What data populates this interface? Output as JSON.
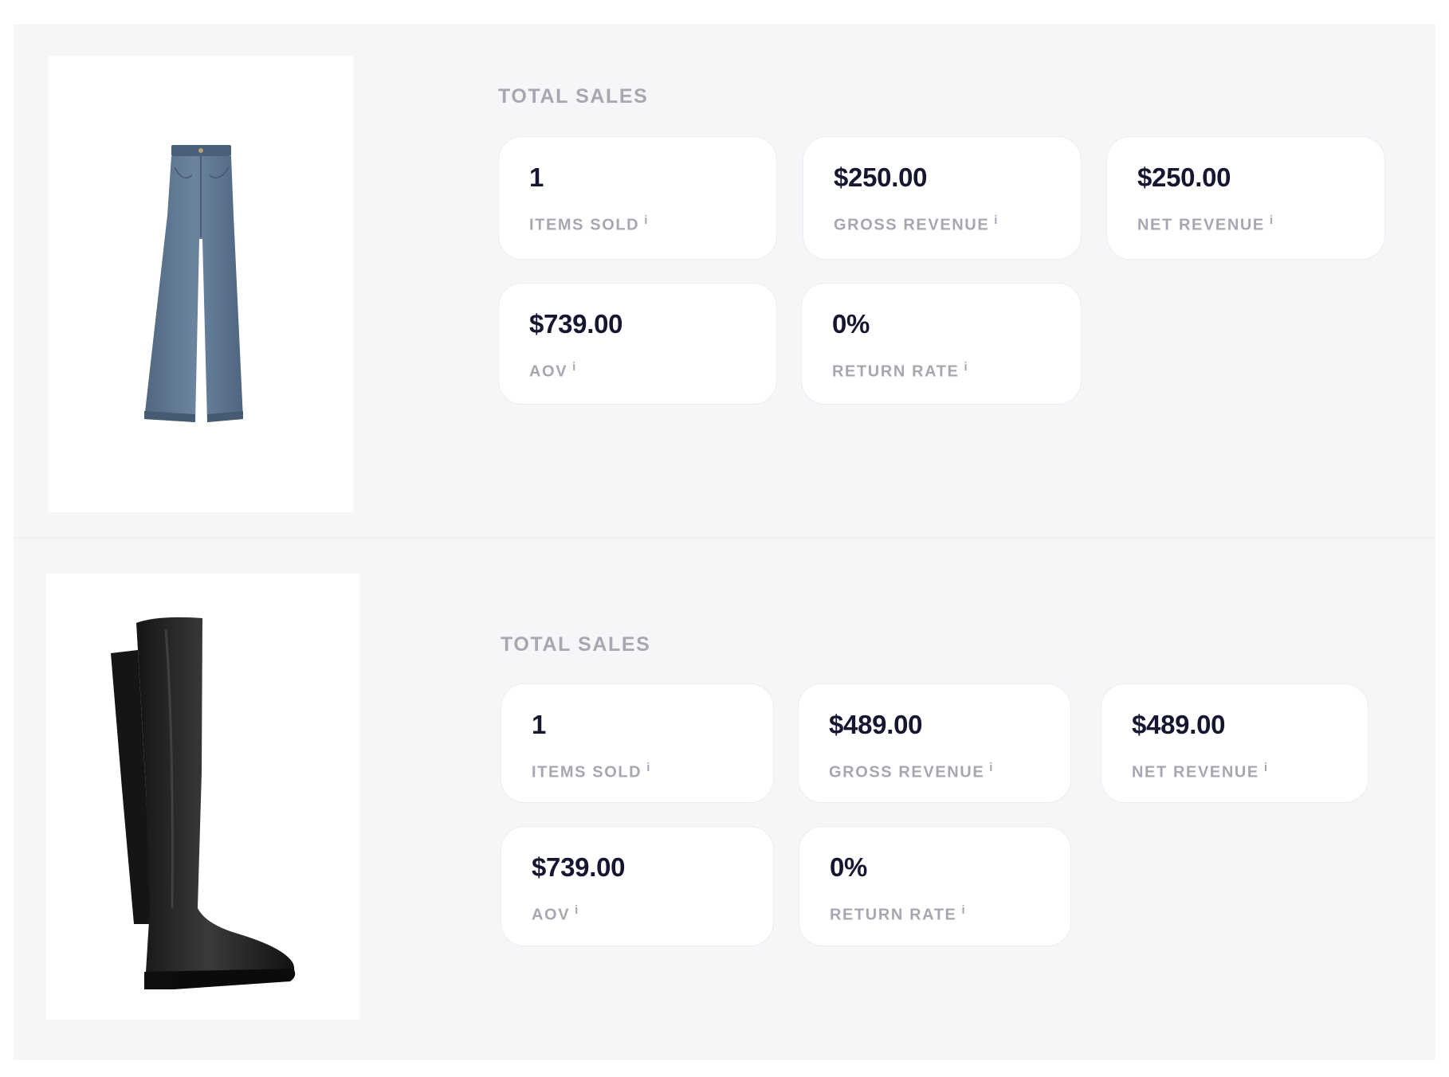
{
  "products": [
    {
      "image_alt": "wide-leg denim jeans",
      "section_title": "TOTAL SALES",
      "metrics": [
        {
          "value": "1",
          "label": "ITEMS SOLD",
          "info": "i"
        },
        {
          "value": "$250.00",
          "label": "GROSS REVENUE",
          "info": "i"
        },
        {
          "value": "$250.00",
          "label": "NET REVENUE",
          "info": "i"
        },
        {
          "value": "$739.00",
          "label": "AOV",
          "info": "i"
        },
        {
          "value": "0%",
          "label": "RETURN RATE",
          "info": "i"
        }
      ]
    },
    {
      "image_alt": "black over-the-knee boot",
      "section_title": "TOTAL SALES",
      "metrics": [
        {
          "value": "1",
          "label": "ITEMS SOLD",
          "info": "i"
        },
        {
          "value": "$489.00",
          "label": "GROSS REVENUE",
          "info": "i"
        },
        {
          "value": "$489.00",
          "label": "NET REVENUE",
          "info": "i"
        },
        {
          "value": "$739.00",
          "label": "AOV",
          "info": "i"
        },
        {
          "value": "0%",
          "label": "RETURN RATE",
          "info": "i"
        }
      ]
    }
  ],
  "colors": {
    "panel_bg": "#f6f6f8",
    "card_bg": "#ffffff",
    "value_text": "#161630",
    "muted_text": "#a7a7b1",
    "denim": "#5f7893",
    "boot": "#1e1e1f"
  }
}
